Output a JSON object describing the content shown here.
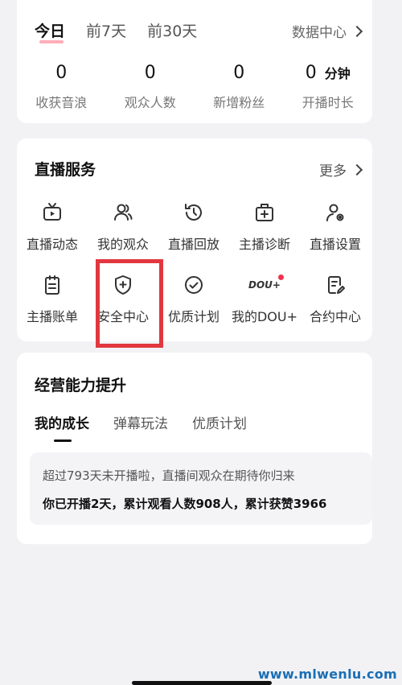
{
  "stats": {
    "tabs": [
      "今日",
      "前7天",
      "前30天"
    ],
    "data_center_label": "数据中心",
    "items": [
      {
        "value": "0",
        "unit": "",
        "label": "收获音浪"
      },
      {
        "value": "0",
        "unit": "",
        "label": "观众人数"
      },
      {
        "value": "0",
        "unit": "",
        "label": "新增粉丝"
      },
      {
        "value": "0",
        "unit": "分钟",
        "label": "开播时长"
      }
    ]
  },
  "services": {
    "title": "直播服务",
    "more_label": "更多",
    "row1": [
      {
        "label": "直播动态",
        "icon": "tv-icon"
      },
      {
        "label": "我的观众",
        "icon": "users-icon"
      },
      {
        "label": "直播回放",
        "icon": "history-icon"
      },
      {
        "label": "主播诊断",
        "icon": "medical-kit-icon"
      },
      {
        "label": "直播设置",
        "icon": "user-settings-icon"
      }
    ],
    "row2": [
      {
        "label": "主播账单",
        "icon": "clipboard-icon"
      },
      {
        "label": "安全中心",
        "icon": "shield-plus-icon"
      },
      {
        "label": "优质计划",
        "icon": "check-circle-icon"
      },
      {
        "label": "我的DOU+",
        "icon": "dou-logo",
        "logo_text": "DOU+"
      },
      {
        "label": "合约中心",
        "icon": "contract-edit-icon"
      }
    ],
    "badge_color": "#f0344f",
    "highlight_color": "#e2373e"
  },
  "growth": {
    "title": "经营能力提升",
    "tabs": [
      "我的成长",
      "弹幕玩法",
      "优质计划"
    ],
    "info_line1": "超过793天未开播啦，直播间观众在期待你归来",
    "info_line2": "你已开播2天，累计观看人数908人，累计获赞3966"
  },
  "watermark": "www.mlwenlu.com"
}
